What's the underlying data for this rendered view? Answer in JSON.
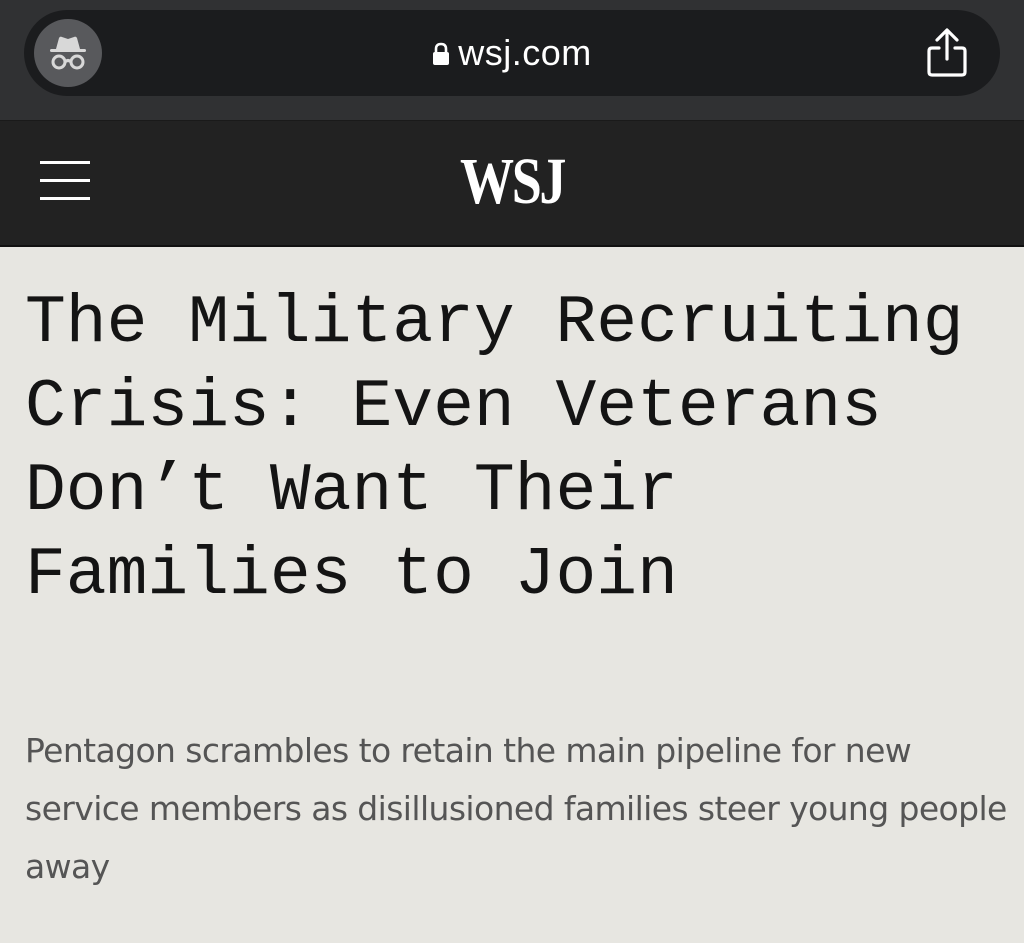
{
  "browser": {
    "url": "wsj.com",
    "incognito_icon": "incognito-icon",
    "lock_icon": "lock-icon",
    "share_icon": "share-icon"
  },
  "site": {
    "logo": "WSJ",
    "menu_icon": "hamburger-menu-icon",
    "header_bg": "#222222"
  },
  "article": {
    "headline": "The Military Recruiting Crisis: Even Veterans Don’t Want Their Families to Join",
    "dek": "Pentagon scrambles to retain the main pipeline for new service members as disillusioned families steer young people away"
  },
  "colors": {
    "page_bg": "#e7e6e1",
    "headline": "#141414",
    "dek": "#555555"
  }
}
